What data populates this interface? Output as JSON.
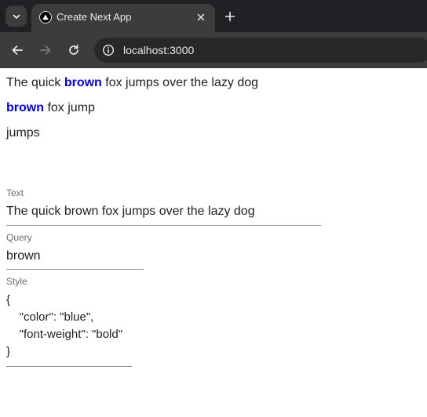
{
  "browser": {
    "tab": {
      "title": "Create Next App",
      "favicon": "nextjs-logo-icon"
    },
    "url": "localhost:3000",
    "icons": {
      "tab_list": "chevron-down-icon",
      "close": "close-icon",
      "new_tab": "plus-icon",
      "back": "arrow-left-icon",
      "forward": "arrow-right-icon",
      "reload": "reload-icon",
      "site_info": "info-icon"
    },
    "colors": {
      "tab_bar": "#202124",
      "toolbar": "#3c3c3c",
      "omnibox": "#282828"
    }
  },
  "highlight_results": [
    {
      "before": "The quick ",
      "match": "brown",
      "after": " fox jumps over the lazy dog"
    },
    {
      "before": "",
      "match": "brown",
      "after": " fox jump"
    },
    {
      "before": "jumps",
      "match": "",
      "after": ""
    }
  ],
  "highlight_color": "#0000ff",
  "form": {
    "text": {
      "label": "Text",
      "value": "The quick brown fox jumps over the lazy dog"
    },
    "query": {
      "label": "Query",
      "value": "brown"
    },
    "style": {
      "label": "Style",
      "value": "{\n    \"color\": \"blue\",\n    \"font-weight\": \"bold\"\n}"
    }
  }
}
